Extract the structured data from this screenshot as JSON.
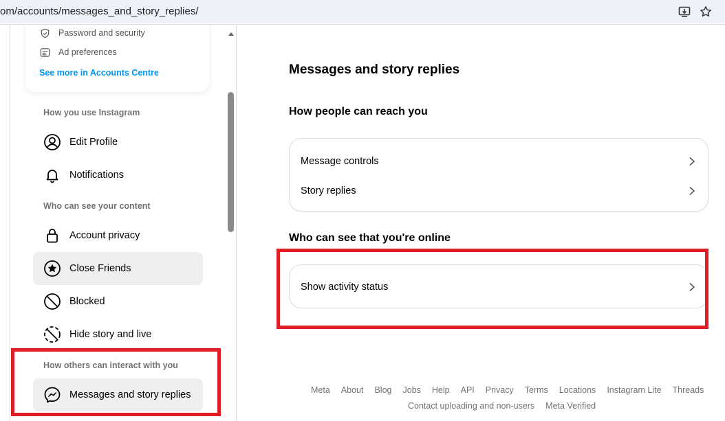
{
  "browser": {
    "url": "om/accounts/messages_and_story_replies/"
  },
  "sidebar": {
    "accounts_centre": {
      "items": [
        {
          "label": "Password and security",
          "icon": "shield-check-icon"
        },
        {
          "label": "Ad preferences",
          "icon": "ad-preferences-icon"
        }
      ],
      "see_more": "See more in Accounts Centre"
    },
    "sections": [
      {
        "label": "How you use Instagram"
      },
      {
        "label": "Who can see your content"
      },
      {
        "label": "How others can interact with you"
      }
    ],
    "items": [
      {
        "label": "Edit Profile",
        "icon": "profile-circle-icon"
      },
      {
        "label": "Notifications",
        "icon": "bell-icon"
      },
      {
        "label": "Account privacy",
        "icon": "lock-icon"
      },
      {
        "label": "Close Friends",
        "icon": "star-circle-icon"
      },
      {
        "label": "Blocked",
        "icon": "blocked-icon"
      },
      {
        "label": "Hide story and live",
        "icon": "hide-story-icon"
      },
      {
        "label": "Messages and story replies",
        "icon": "messenger-icon"
      }
    ]
  },
  "main": {
    "title": "Messages and story replies",
    "reach_heading": "How people can reach you",
    "reach_items": [
      {
        "label": "Message controls"
      },
      {
        "label": "Story replies"
      }
    ],
    "online_heading": "Who can see that you're online",
    "online_items": [
      {
        "label": "Show activity status"
      }
    ]
  },
  "footer": {
    "links": [
      "Meta",
      "About",
      "Blog",
      "Jobs",
      "Help",
      "API",
      "Privacy",
      "Terms",
      "Locations",
      "Instagram Lite",
      "Threads"
    ],
    "links2": [
      "Contact uploading and non-users",
      "Meta Verified"
    ]
  },
  "colors": {
    "highlight_red": "#e01e25",
    "link_blue": "#0095f6",
    "active_bg": "#efefef"
  }
}
